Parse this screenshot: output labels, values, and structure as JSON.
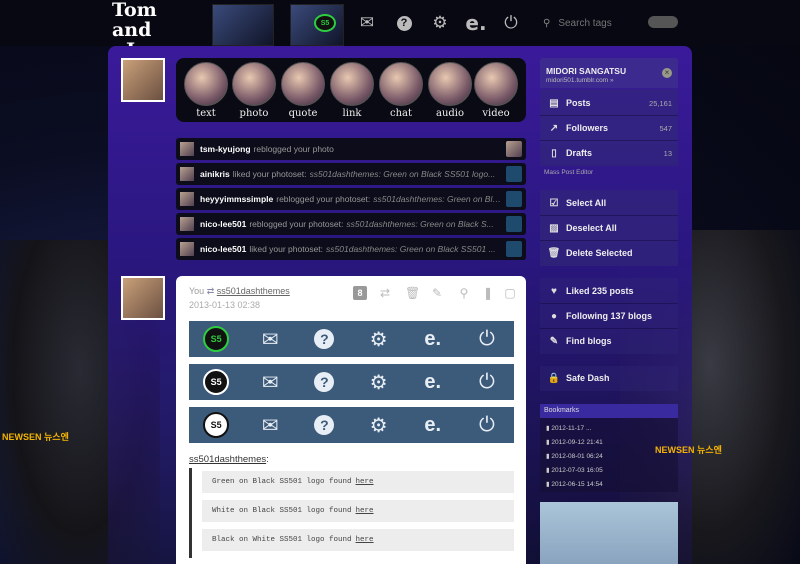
{
  "header": {
    "logo_line1": "Tom and",
    "logo_line2": "Jerry",
    "search_placeholder": "Search tags",
    "icons": [
      "s5-logo-icon",
      "mail-icon",
      "help-icon",
      "gear-icon",
      "dashboard-e-icon",
      "power-icon"
    ]
  },
  "post_types": [
    {
      "label": "text"
    },
    {
      "label": "photo"
    },
    {
      "label": "quote"
    },
    {
      "label": "link"
    },
    {
      "label": "chat"
    },
    {
      "label": "audio"
    },
    {
      "label": "video"
    }
  ],
  "notifications": [
    {
      "user": "tsm-kyujong",
      "action": "reblogged your photo",
      "target": ""
    },
    {
      "user": "ainikris",
      "action": "liked your photoset:",
      "target": "ss501dashthemes: Green on Black SS501 logo..."
    },
    {
      "user": "heyyyimmssimple",
      "action": "reblogged your photoset:",
      "target": "ss501dashthemes: Green on Black SS501..."
    },
    {
      "user": "nico-lee501",
      "action": "reblogged your photoset:",
      "target": "ss501dashthemes: Green on Black S..."
    },
    {
      "user": "nico-lee501",
      "action": "liked your photoset:",
      "target": "ss501dashthemes: Green on Black SS501 ..."
    }
  ],
  "post": {
    "author": "You",
    "reblog_from": "ss501dashthemes",
    "date": "2013-01-13 02:38",
    "note_count": "8",
    "source_label": "ss501dashthemes",
    "quote_lines": [
      {
        "text": "Green on Black SS501 logo found",
        "link": "here"
      },
      {
        "text": "White on Black SS501 logo found",
        "link": "here"
      },
      {
        "text": "Black on White SS501 logo found",
        "link": "here"
      }
    ]
  },
  "sidebar": {
    "account_name": "MIDORI SANGATSU",
    "account_url": "midori501.tumblr.com »",
    "posts_label": "Posts",
    "posts_count": "25,161",
    "followers_label": "Followers",
    "followers_count": "547",
    "drafts_label": "Drafts",
    "drafts_count": "13",
    "mass_post_editor": "Mass Post Editor",
    "select_all": "Select All",
    "deselect_all": "Deselect All",
    "delete_selected": "Delete Selected",
    "liked": "Liked 235 posts",
    "following": "Following 137 blogs",
    "find_blogs": "Find blogs",
    "safe_dash": "Safe Dash",
    "bookmarks_title": "Bookmarks",
    "bookmarks": [
      "2012-11-17 ...",
      "2012-09-12 21:41",
      "2012-08-01 06:24",
      "2012-07-03 16:05",
      "2012-06-15 14:54"
    ]
  },
  "photo_watermark": "NEWSEN 뉴스엔",
  "colors": {
    "accent": "#3a1a9a",
    "dashbar": "#3c5a79",
    "logo_green": "#2ecc40"
  }
}
